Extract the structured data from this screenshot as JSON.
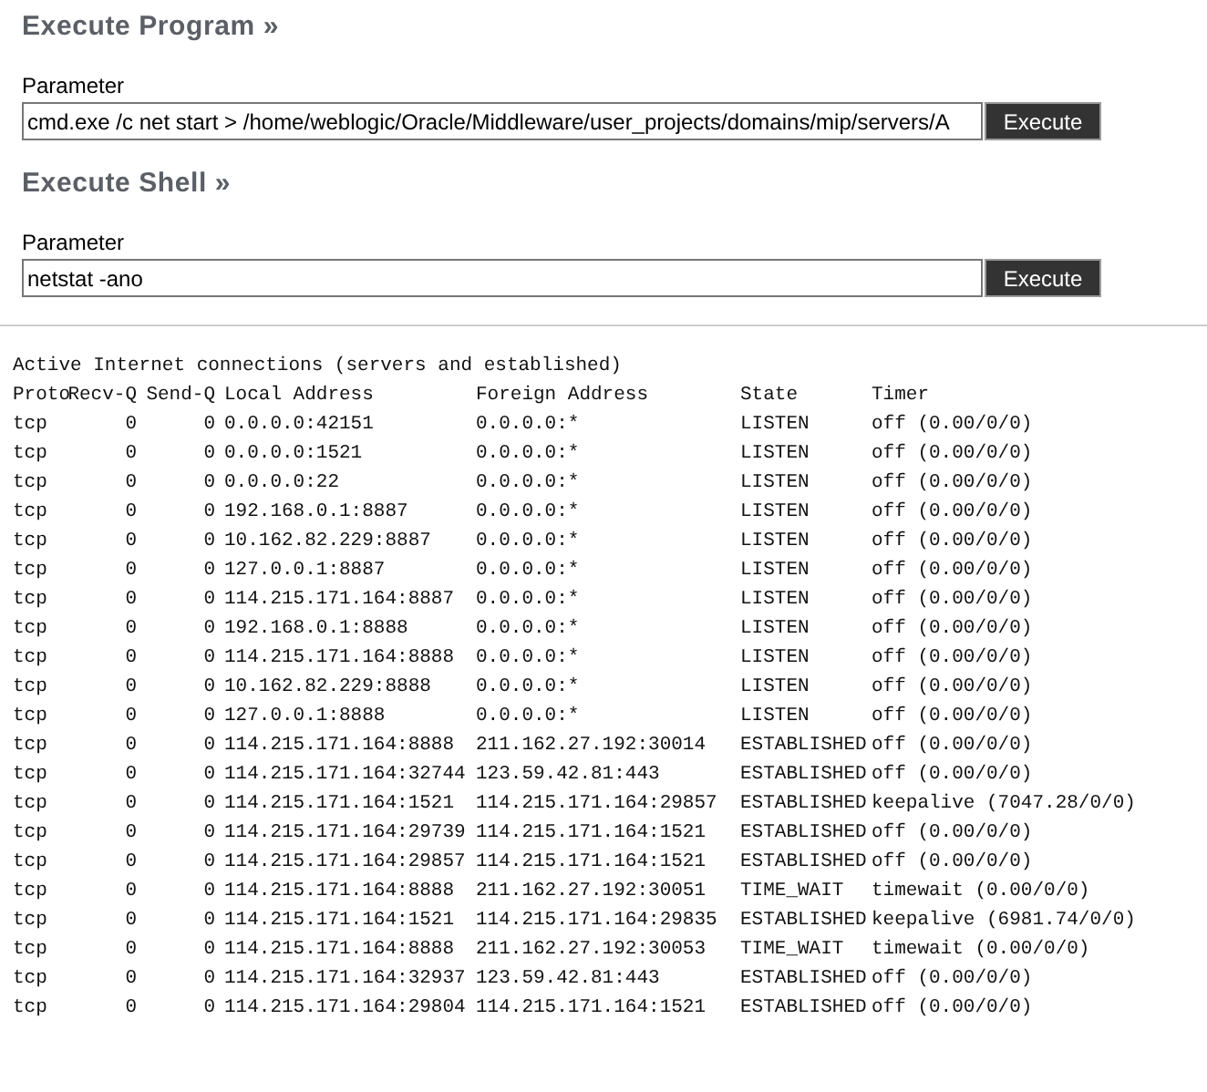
{
  "sections": [
    {
      "heading": "Execute Program »",
      "label": "Parameter",
      "value": "cmd.exe /c net start > /home/weblogic/Oracle/Middleware/user_projects/domains/mip/servers/A",
      "button": "Execute"
    },
    {
      "heading": "Execute Shell »",
      "label": "Parameter",
      "value": "netstat -ano",
      "button": "Execute"
    }
  ],
  "output": {
    "title": "Active Internet connections (servers and established)",
    "columns": [
      "Proto",
      "Recv-Q",
      "Send-Q",
      "Local Address",
      "Foreign Address",
      "State",
      "Timer"
    ],
    "rows": [
      [
        "tcp",
        "0",
        "0",
        "0.0.0.0:42151",
        "0.0.0.0:*",
        "LISTEN",
        "off (0.00/0/0)"
      ],
      [
        "tcp",
        "0",
        "0",
        "0.0.0.0:1521",
        "0.0.0.0:*",
        "LISTEN",
        "off (0.00/0/0)"
      ],
      [
        "tcp",
        "0",
        "0",
        "0.0.0.0:22",
        "0.0.0.0:*",
        "LISTEN",
        "off (0.00/0/0)"
      ],
      [
        "tcp",
        "0",
        "0",
        "192.168.0.1:8887",
        "0.0.0.0:*",
        "LISTEN",
        "off (0.00/0/0)"
      ],
      [
        "tcp",
        "0",
        "0",
        "10.162.82.229:8887",
        "0.0.0.0:*",
        "LISTEN",
        "off (0.00/0/0)"
      ],
      [
        "tcp",
        "0",
        "0",
        "127.0.0.1:8887",
        "0.0.0.0:*",
        "LISTEN",
        "off (0.00/0/0)"
      ],
      [
        "tcp",
        "0",
        "0",
        "114.215.171.164:8887",
        "0.0.0.0:*",
        "LISTEN",
        "off (0.00/0/0)"
      ],
      [
        "tcp",
        "0",
        "0",
        "192.168.0.1:8888",
        "0.0.0.0:*",
        "LISTEN",
        "off (0.00/0/0)"
      ],
      [
        "tcp",
        "0",
        "0",
        "114.215.171.164:8888",
        "0.0.0.0:*",
        "LISTEN",
        "off (0.00/0/0)"
      ],
      [
        "tcp",
        "0",
        "0",
        "10.162.82.229:8888",
        "0.0.0.0:*",
        "LISTEN",
        "off (0.00/0/0)"
      ],
      [
        "tcp",
        "0",
        "0",
        "127.0.0.1:8888",
        "0.0.0.0:*",
        "LISTEN",
        "off (0.00/0/0)"
      ],
      [
        "tcp",
        "0",
        "0",
        "114.215.171.164:8888",
        "211.162.27.192:30014",
        "ESTABLISHED",
        "off (0.00/0/0)"
      ],
      [
        "tcp",
        "0",
        "0",
        "114.215.171.164:32744",
        "123.59.42.81:443",
        "ESTABLISHED",
        "off (0.00/0/0)"
      ],
      [
        "tcp",
        "0",
        "0",
        "114.215.171.164:1521",
        "114.215.171.164:29857",
        "ESTABLISHED",
        "keepalive (7047.28/0/0)"
      ],
      [
        "tcp",
        "0",
        "0",
        "114.215.171.164:29739",
        "114.215.171.164:1521",
        "ESTABLISHED",
        "off (0.00/0/0)"
      ],
      [
        "tcp",
        "0",
        "0",
        "114.215.171.164:29857",
        "114.215.171.164:1521",
        "ESTABLISHED",
        "off (0.00/0/0)"
      ],
      [
        "tcp",
        "0",
        "0",
        "114.215.171.164:8888",
        "211.162.27.192:30051",
        "TIME_WAIT",
        "timewait (0.00/0/0)"
      ],
      [
        "tcp",
        "0",
        "0",
        "114.215.171.164:1521",
        "114.215.171.164:29835",
        "ESTABLISHED",
        "keepalive (6981.74/0/0)"
      ],
      [
        "tcp",
        "0",
        "0",
        "114.215.171.164:8888",
        "211.162.27.192:30053",
        "TIME_WAIT",
        "timewait (0.00/0/0)"
      ],
      [
        "tcp",
        "0",
        "0",
        "114.215.171.164:32937",
        "123.59.42.81:443",
        "ESTABLISHED",
        "off (0.00/0/0)"
      ],
      [
        "tcp",
        "0",
        "0",
        "114.215.171.164:29804",
        "114.215.171.164:1521",
        "ESTABLISHED",
        "off (0.00/0/0)"
      ]
    ]
  }
}
